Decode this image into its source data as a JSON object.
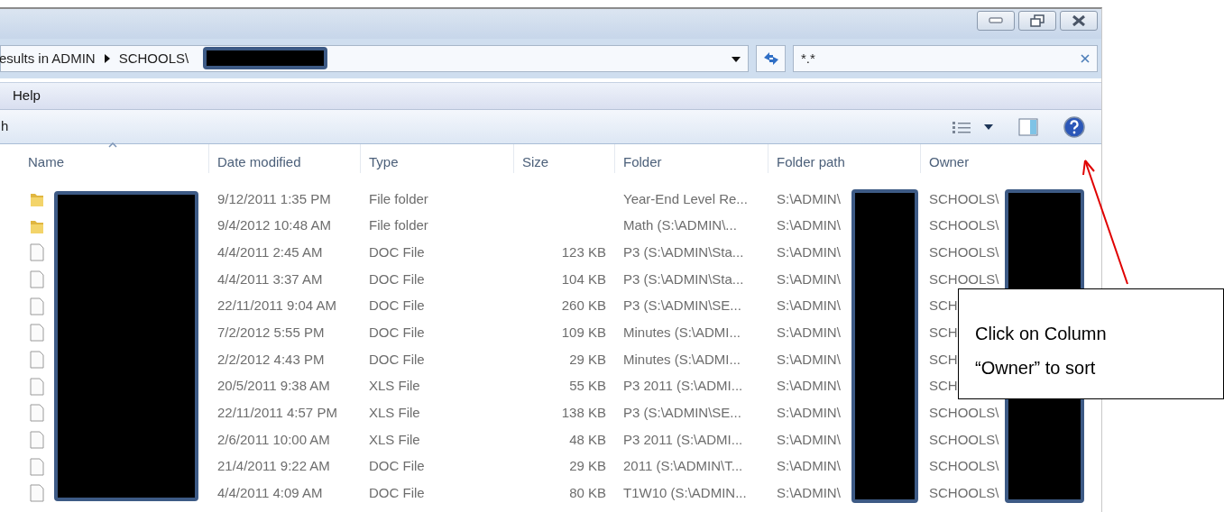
{
  "address": {
    "crumbs": [
      "esults in ADMIN",
      "SCHOOLS\\"
    ]
  },
  "search": {
    "value": "*.*"
  },
  "menu": [
    "Help"
  ],
  "toolbar": {
    "label": "h"
  },
  "columns": [
    {
      "label": "Name",
      "sorted": true
    },
    {
      "label": "Date modified",
      "sorted": false
    },
    {
      "label": "Type",
      "sorted": false
    },
    {
      "label": "Size",
      "sorted": false
    },
    {
      "label": "Folder",
      "sorted": false
    },
    {
      "label": "Folder path",
      "sorted": false
    },
    {
      "label": "Owner",
      "sorted": false
    }
  ],
  "rows": [
    {
      "kind": "folder",
      "date": "9/12/2011 1:35 PM",
      "type": "File folder",
      "folder": "Year-End Level Re...",
      "folder_path": "S:\\ADMIN\\",
      "owner": "SCHOOLS\\"
    },
    {
      "kind": "folder",
      "date": "9/4/2012 10:48 AM",
      "type": "File folder",
      "folder": "Math (S:\\ADMIN\\...",
      "folder_path": "S:\\ADMIN\\",
      "owner": "SCHOOLS\\"
    },
    {
      "kind": "file",
      "date": "4/4/2011 2:45 AM",
      "type": "DOC File",
      "size": "123 KB",
      "folder": "P3 (S:\\ADMIN\\Sta...",
      "folder_path": "S:\\ADMIN\\",
      "owner": "SCHOOLS\\"
    },
    {
      "kind": "file",
      "date": "4/4/2011 3:37 AM",
      "type": "DOC File",
      "size": "104 KB",
      "folder": "P3 (S:\\ADMIN\\Sta...",
      "folder_path": "S:\\ADMIN\\",
      "owner": "SCHOOLS\\"
    },
    {
      "kind": "file",
      "date": "22/11/2011 9:04 AM",
      "type": "DOC File",
      "size": "260 KB",
      "folder": "P3 (S:\\ADMIN\\SE...",
      "folder_path": "S:\\ADMIN\\",
      "owner": "SCH"
    },
    {
      "kind": "file",
      "date": "7/2/2012 5:55 PM",
      "type": "DOC File",
      "size": "109 KB",
      "folder": "Minutes (S:\\ADMI...",
      "folder_path": "S:\\ADMIN\\",
      "owner": "SCH"
    },
    {
      "kind": "file",
      "date": "2/2/2012 4:43 PM",
      "type": "DOC File",
      "size": "29 KB",
      "folder": "Minutes (S:\\ADMI...",
      "folder_path": "S:\\ADMIN\\",
      "owner": "SCH"
    },
    {
      "kind": "file",
      "date": "20/5/2011 9:38 AM",
      "type": "XLS File",
      "size": "55 KB",
      "folder": "P3 2011 (S:\\ADMI...",
      "folder_path": "S:\\ADMIN\\",
      "owner": "SCH"
    },
    {
      "kind": "file",
      "date": "22/11/2011 4:57 PM",
      "type": "XLS File",
      "size": "138 KB",
      "folder": "P3 (S:\\ADMIN\\SE...",
      "folder_path": "S:\\ADMIN\\",
      "owner": "SCHOOLS\\"
    },
    {
      "kind": "file",
      "date": "2/6/2011 10:00 AM",
      "type": "XLS File",
      "size": "48 KB",
      "folder": "P3 2011 (S:\\ADMI...",
      "folder_path": "S:\\ADMIN\\",
      "owner": "SCHOOLS\\"
    },
    {
      "kind": "file",
      "date": "21/4/2011 9:22 AM",
      "type": "DOC File",
      "size": "29 KB",
      "folder": "2011 (S:\\ADMIN\\T...",
      "folder_path": "S:\\ADMIN\\",
      "owner": "SCHOOLS\\"
    },
    {
      "kind": "file",
      "date": "4/4/2011 4:09 AM",
      "type": "DOC File",
      "size": "80 KB",
      "folder": "T1W10 (S:\\ADMIN...",
      "folder_path": "S:\\ADMIN\\",
      "owner": "SCHOOLS\\"
    }
  ],
  "callout": {
    "text": "Click on Column “Owner” to sort"
  }
}
